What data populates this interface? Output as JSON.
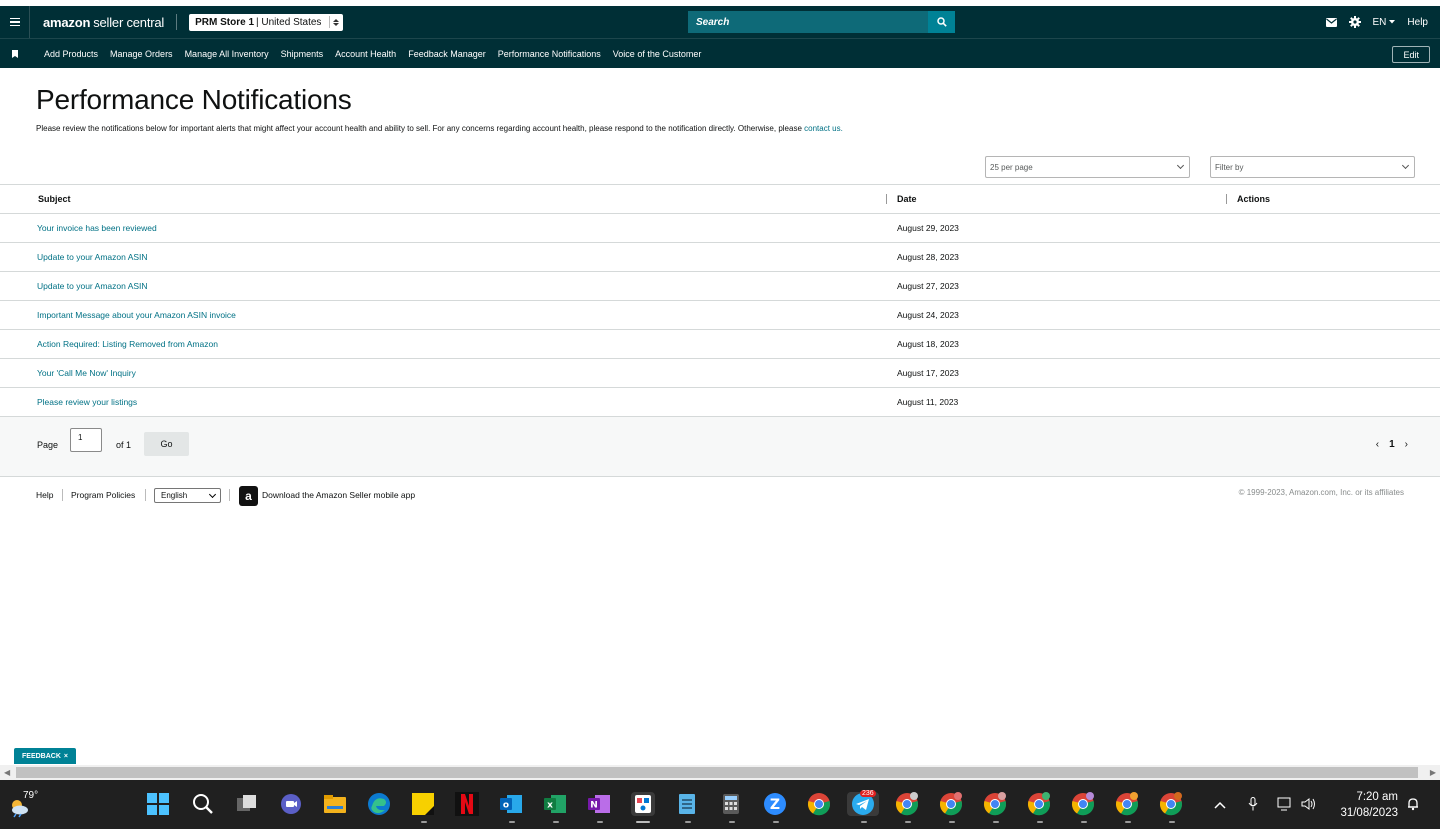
{
  "header": {
    "logo_brand": "amazon",
    "logo_rest": "seller central",
    "store_name": "PRM Store 1",
    "store_region": "| United States",
    "search_placeholder": "Search",
    "language": "EN",
    "help": "Help"
  },
  "nav": {
    "items": [
      "Add Products",
      "Manage Orders",
      "Manage All Inventory",
      "Shipments",
      "Account Health",
      "Feedback Manager",
      "Performance Notifications",
      "Voice of the Customer"
    ],
    "edit": "Edit"
  },
  "page": {
    "title": "Performance Notifications",
    "description": "Please review the notifications below for important alerts that might affect your account health and ability to sell. For any concerns regarding account health, please respond to the notification directly. Otherwise, please ",
    "contact_link": "contact us.",
    "per_page": "25 per page",
    "filter_placeholder": "Filter by"
  },
  "table": {
    "headers": {
      "subject": "Subject",
      "date": "Date",
      "actions": "Actions"
    },
    "rows": [
      {
        "subject": "Your invoice has been reviewed",
        "date": "August 29, 2023"
      },
      {
        "subject": "Update to your Amazon ASIN",
        "date": "August 28, 2023"
      },
      {
        "subject": "Update to your Amazon ASIN",
        "date": "August 27, 2023"
      },
      {
        "subject": "Important Message about your Amazon ASIN invoice",
        "date": "August 24, 2023"
      },
      {
        "subject": "Action Required: Listing Removed from Amazon",
        "date": "August 18, 2023"
      },
      {
        "subject": "Your 'Call Me Now' Inquiry",
        "date": "August 17, 2023"
      },
      {
        "subject": "Please review your listings",
        "date": "August 11, 2023"
      }
    ]
  },
  "pagination": {
    "page_label": "Page",
    "page_value": "1",
    "of_label": "of 1",
    "go": "Go",
    "prev": "‹",
    "current": "1",
    "next": "›"
  },
  "footer": {
    "help": "Help",
    "program_policies": "Program Policies",
    "language": "English",
    "app_logo": "a",
    "app_download": "Download the Amazon Seller mobile app",
    "copyright": "© 1999-2023, Amazon.com, Inc. or its affiliates"
  },
  "feedback": "FEEDBACK",
  "feedback_close": "×",
  "taskbar": {
    "weather_temp": "79°",
    "time": "7:20 am",
    "date": "31/08/2023",
    "telegram_badge": "236",
    "apps": [
      "start-icon",
      "search-icon",
      "task-view-icon",
      "teams-icon",
      "file-explorer-icon",
      "edge-icon",
      "sticky-notes-icon",
      "netflix-icon",
      "outlook-icon",
      "excel-icon",
      "onenote-icon",
      "snipping-tool-icon",
      "notepad-icon",
      "calculator-icon",
      "zoom-icon",
      "chrome-icon",
      "telegram-icon",
      "chrome-profile-1-icon",
      "chrome-profile-2-icon",
      "chrome-profile-3-icon",
      "chrome-profile-4-icon",
      "chrome-profile-5-icon",
      "chrome-profile-6-icon",
      "chrome-profile-7-icon"
    ]
  },
  "colors": {
    "header_bg": "#002f36",
    "search_bg": "#0e6a78",
    "accent_teal": "#008296",
    "link": "#007185",
    "taskbar_bg": "#202020"
  }
}
